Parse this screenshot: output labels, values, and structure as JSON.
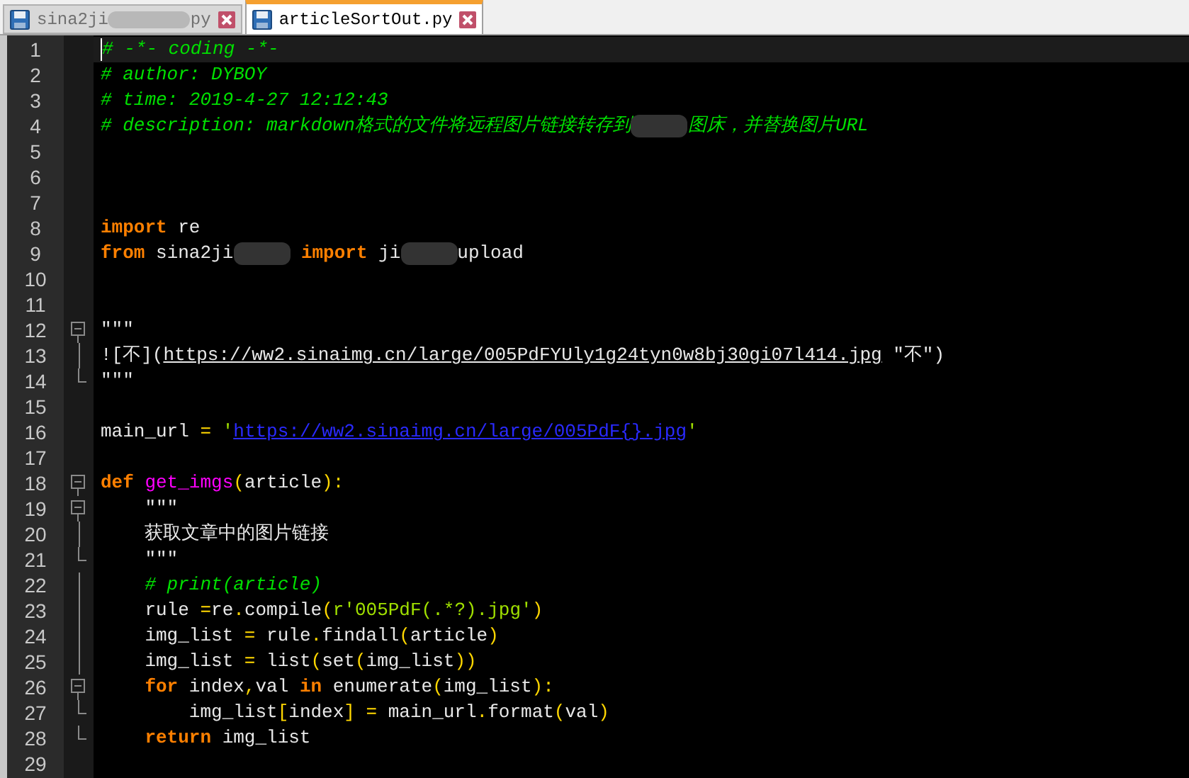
{
  "tabs": [
    {
      "label_parts": [
        {
          "text": "sina2ji",
          "kind": "text"
        },
        {
          "kind": "redacted"
        },
        {
          "text": "py",
          "kind": "text"
        }
      ],
      "selected": false
    },
    {
      "label_parts": [
        {
          "text": "articleSortOut.py",
          "kind": "text"
        }
      ],
      "selected": true
    }
  ],
  "editor": {
    "lines": [
      {
        "number": "1",
        "current": true,
        "tokens": [
          {
            "text": "# -*- coding -*-",
            "kind": "comment"
          }
        ]
      },
      {
        "number": "2",
        "tokens": [
          {
            "text": "# author: DYBOY",
            "kind": "comment"
          }
        ]
      },
      {
        "number": "3",
        "tokens": [
          {
            "text": "# time: 2019-4-27 12:12:43",
            "kind": "comment"
          }
        ]
      },
      {
        "number": "4",
        "tokens": [
          {
            "text": "# description: markdown格式的文件将远程图片链接转存到",
            "kind": "comment"
          },
          {
            "kind": "redacted"
          },
          {
            "text": "图床，并替换图片URL",
            "kind": "comment"
          }
        ]
      },
      {
        "number": "5"
      },
      {
        "number": "6"
      },
      {
        "number": "7"
      },
      {
        "number": "8",
        "tokens": [
          {
            "text": "import",
            "kind": "keyword"
          },
          {
            "text": " re",
            "kind": "plain"
          }
        ]
      },
      {
        "number": "9",
        "tokens": [
          {
            "text": "from",
            "kind": "keyword"
          },
          {
            "text": " sina2ji",
            "kind": "plain"
          },
          {
            "kind": "redacted"
          },
          {
            "text": " import",
            "kind": "keyword"
          },
          {
            "text": " ji",
            "kind": "plain"
          },
          {
            "kind": "redacted"
          },
          {
            "text": "upload",
            "kind": "plain"
          }
        ]
      },
      {
        "number": "10"
      },
      {
        "number": "11"
      },
      {
        "number": "12",
        "fold_start": true,
        "tokens": [
          {
            "text": "\"\"\"",
            "kind": "plain"
          }
        ]
      },
      {
        "number": "13",
        "fold_inside": true,
        "tokens": [
          {
            "text": "![不](",
            "kind": "plain"
          },
          {
            "text": "https://ww2.sinaimg.cn/large/005PdFYUly1g24tyn0w8bj30gi07l414.jpg",
            "kind": "link"
          },
          {
            "text": " \"不\")",
            "kind": "plain"
          }
        ]
      },
      {
        "number": "14",
        "fold_end": true,
        "tokens": [
          {
            "text": "\"\"\"",
            "kind": "plain"
          }
        ]
      },
      {
        "number": "15"
      },
      {
        "number": "16",
        "tokens": [
          {
            "text": "main_url ",
            "kind": "plain"
          },
          {
            "text": "=",
            "kind": "operator"
          },
          {
            "text": " '",
            "kind": "string"
          },
          {
            "text": "https://ww2.sinaimg.cn/large/005PdF{}.jpg",
            "kind": "url"
          },
          {
            "text": "'",
            "kind": "string"
          }
        ]
      },
      {
        "number": "17"
      },
      {
        "number": "18",
        "fold_start": true,
        "tokens": [
          {
            "text": "def",
            "kind": "keyword"
          },
          {
            "text": " get_imgs",
            "kind": "function"
          },
          {
            "text": "(",
            "kind": "operator"
          },
          {
            "text": "article",
            "kind": "plain"
          },
          {
            "text": "):",
            "kind": "operator"
          }
        ]
      },
      {
        "number": "19",
        "fold_start": true,
        "tokens": [
          {
            "text": "    \"\"\"",
            "kind": "plain"
          }
        ]
      },
      {
        "number": "20",
        "fold_inside": true,
        "tokens": [
          {
            "text": "    获取文章中的图片链接",
            "kind": "plain"
          }
        ]
      },
      {
        "number": "21",
        "fold_end": true,
        "tokens": [
          {
            "text": "    \"\"\"",
            "kind": "plain"
          }
        ]
      },
      {
        "number": "22",
        "fold_inside": true,
        "tokens": [
          {
            "text": "    # print(article)",
            "kind": "comment"
          }
        ]
      },
      {
        "number": "23",
        "fold_inside": true,
        "tokens": [
          {
            "text": "    rule ",
            "kind": "plain"
          },
          {
            "text": "=",
            "kind": "operator"
          },
          {
            "text": "re",
            "kind": "plain"
          },
          {
            "text": ".",
            "kind": "operator"
          },
          {
            "text": "compile",
            "kind": "plain"
          },
          {
            "text": "(",
            "kind": "operator"
          },
          {
            "text": "r'005PdF(.*?).jpg'",
            "kind": "string"
          },
          {
            "text": ")",
            "kind": "operator"
          }
        ]
      },
      {
        "number": "24",
        "fold_inside": true,
        "tokens": [
          {
            "text": "    img_list ",
            "kind": "plain"
          },
          {
            "text": "=",
            "kind": "operator"
          },
          {
            "text": " rule",
            "kind": "plain"
          },
          {
            "text": ".",
            "kind": "operator"
          },
          {
            "text": "findall",
            "kind": "plain"
          },
          {
            "text": "(",
            "kind": "operator"
          },
          {
            "text": "article",
            "kind": "plain"
          },
          {
            "text": ")",
            "kind": "operator"
          }
        ]
      },
      {
        "number": "25",
        "fold_inside": true,
        "tokens": [
          {
            "text": "    img_list ",
            "kind": "plain"
          },
          {
            "text": "=",
            "kind": "operator"
          },
          {
            "text": " list",
            "kind": "plain"
          },
          {
            "text": "(",
            "kind": "operator"
          },
          {
            "text": "set",
            "kind": "plain"
          },
          {
            "text": "(",
            "kind": "operator"
          },
          {
            "text": "img_list",
            "kind": "plain"
          },
          {
            "text": "))",
            "kind": "operator"
          }
        ]
      },
      {
        "number": "26",
        "fold_start": true,
        "tokens": [
          {
            "text": "    for",
            "kind": "keyword"
          },
          {
            "text": " index",
            "kind": "plain"
          },
          {
            "text": ",",
            "kind": "operator"
          },
          {
            "text": "val",
            "kind": "plain"
          },
          {
            "text": " in",
            "kind": "keyword"
          },
          {
            "text": " enumerate",
            "kind": "plain"
          },
          {
            "text": "(",
            "kind": "operator"
          },
          {
            "text": "img_list",
            "kind": "plain"
          },
          {
            "text": "):",
            "kind": "operator"
          }
        ]
      },
      {
        "number": "27",
        "fold_end": true,
        "tokens": [
          {
            "text": "        img_list",
            "kind": "plain"
          },
          {
            "text": "[",
            "kind": "operator"
          },
          {
            "text": "index",
            "kind": "plain"
          },
          {
            "text": "]",
            "kind": "operator"
          },
          {
            "text": " =",
            "kind": "operator"
          },
          {
            "text": " main_url",
            "kind": "plain"
          },
          {
            "text": ".",
            "kind": "operator"
          },
          {
            "text": "format",
            "kind": "plain"
          },
          {
            "text": "(",
            "kind": "operator"
          },
          {
            "text": "val",
            "kind": "plain"
          },
          {
            "text": ")",
            "kind": "operator"
          }
        ]
      },
      {
        "number": "28",
        "fold_end": true,
        "tokens": [
          {
            "text": "    return",
            "kind": "keyword"
          },
          {
            "text": " img_list",
            "kind": "plain"
          }
        ]
      },
      {
        "number": "29"
      }
    ]
  }
}
